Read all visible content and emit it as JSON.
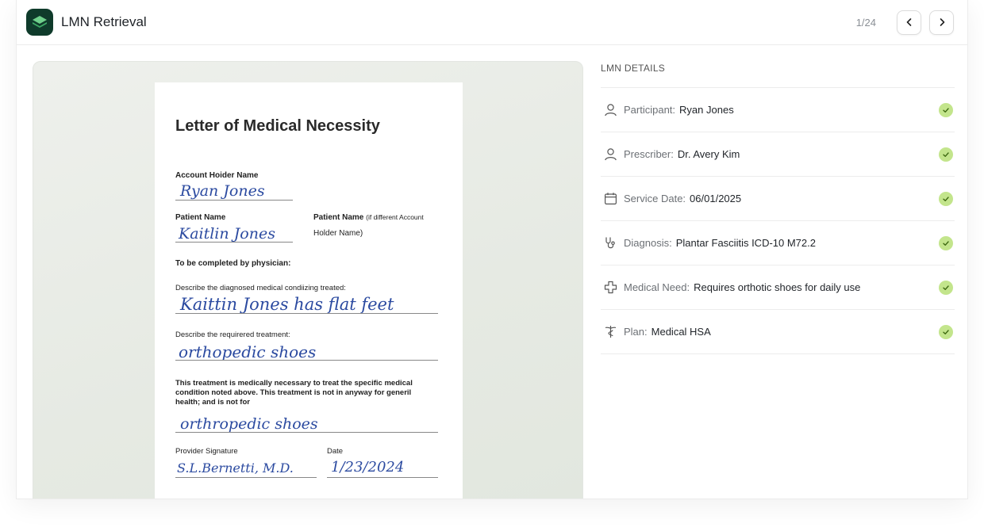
{
  "app": {
    "title": "LMN Retrieval",
    "pager": "1/24"
  },
  "document": {
    "heading": "Letter of Medical Necessity",
    "account_holder_label": "Account Hoider Name",
    "account_holder_value": "Ryan Jones",
    "patient_name_label": "Patient Name",
    "patient_name_value": "Kaitlin Jones",
    "patient_name_alt_label_bold": "Patient Name",
    "patient_name_alt_label_rest": "(if different Account",
    "patient_name_alt_label_line2": "Holder Name)",
    "physician_heading": "To be completed by physician:",
    "condition_prompt": "Describe the diagnosed medical condiizing treated:",
    "condition_value": "Kaittin Jones has flat feet",
    "treatment_prompt": "Describe the requirered treatment:",
    "treatment_value": "orthopedic shoes",
    "necessity_statement": "This treatment is medically necessary to treat the specific medical condition noted above. This treatment is not in anyway for generil health; and is not for",
    "necessity_value": "orthropedic shoes",
    "signature_label": "Provider Signature",
    "signature_value": "S.L.Bernetti, M.D.",
    "date_label": "Date",
    "date_value": "1/23/2024"
  },
  "details": {
    "heading": "LMN DETAILS",
    "check_color": "#c3e58c",
    "rows": [
      {
        "icon": "person-icon",
        "label": "Participant:",
        "value": "Ryan Jones",
        "verified": true
      },
      {
        "icon": "person-icon",
        "label": "Prescriber:",
        "value": "Dr. Avery Kim",
        "verified": true
      },
      {
        "icon": "calendar-icon",
        "label": "Service Date:",
        "value": "06/01/2025",
        "verified": true
      },
      {
        "icon": "stethoscope-icon",
        "label": "Diagnosis:",
        "value": "Plantar Fasciitis ICD-10 M72.2",
        "verified": true
      },
      {
        "icon": "medical-cross-icon",
        "label": "Medical Need:",
        "value": "Requires orthotic shoes for daily use",
        "verified": true
      },
      {
        "icon": "caduceus-icon",
        "label": "Plan:",
        "value": "Medical HSA",
        "verified": true
      }
    ]
  }
}
